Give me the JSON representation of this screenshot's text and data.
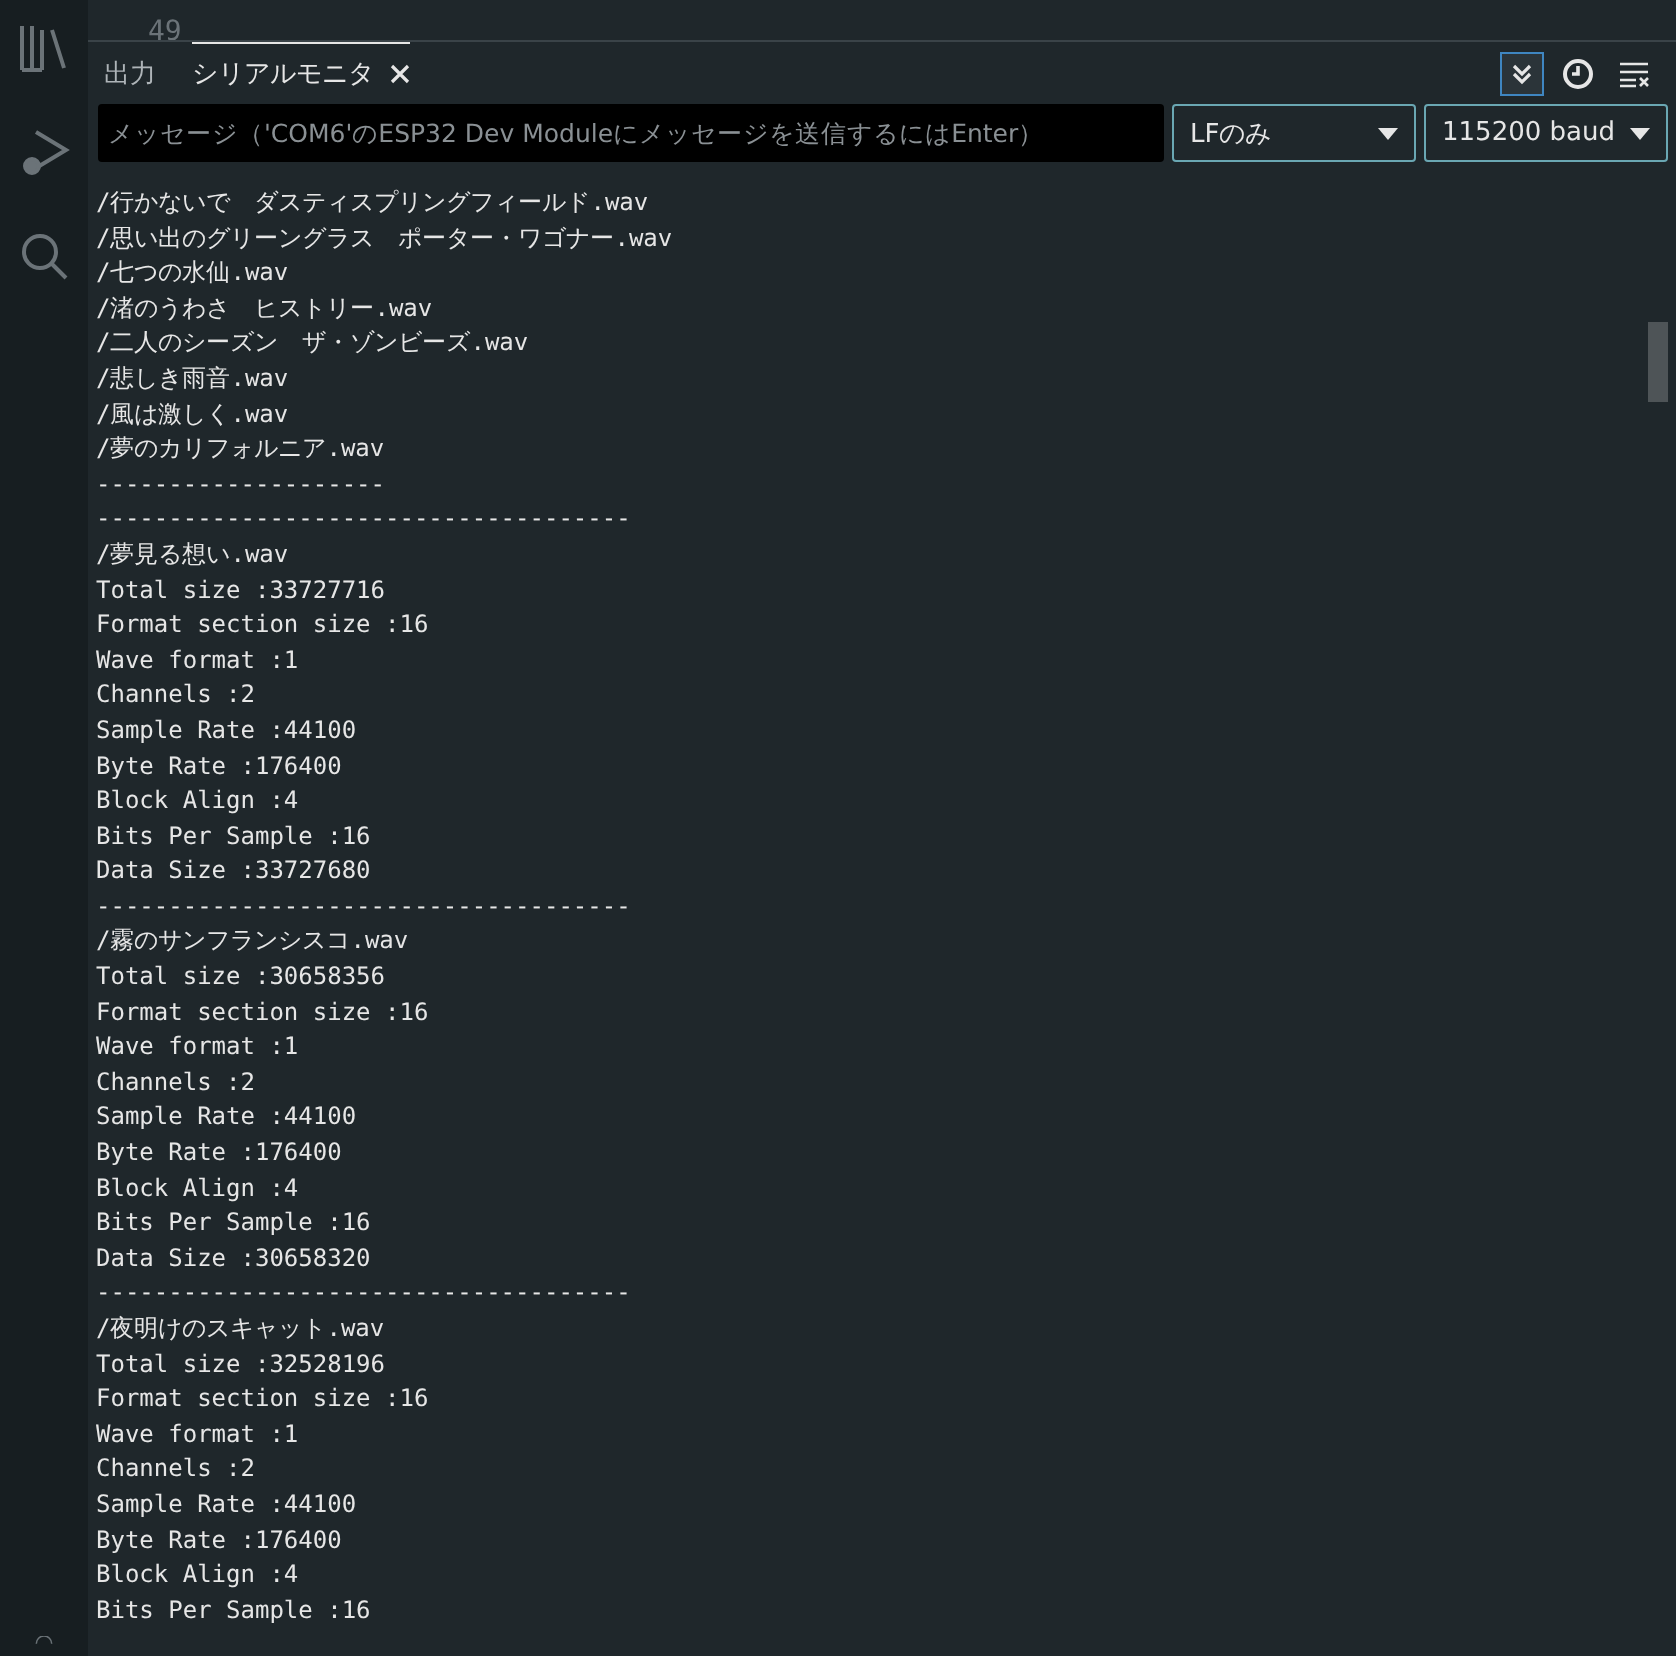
{
  "editor": {
    "line_number": "49"
  },
  "tabs": [
    {
      "label": "出力",
      "selected": false,
      "closable": false
    },
    {
      "label": "シリアルモニタ",
      "selected": true,
      "closable": true
    }
  ],
  "toolbar": {
    "autoscroll_on": true,
    "timestamp_on": false
  },
  "message_field": {
    "placeholder": "メッセージ（'COM6'のESP32 Dev Moduleにメッセージを送信するにはEnter）"
  },
  "line_ending": {
    "value": "LFのみ"
  },
  "baud_rate": {
    "value": "115200 baud"
  },
  "output_lines": [
    "/行かないで　ダスティスプリングフィールド.wav",
    "/思い出のグリーングラス　ポーター・ワゴナー.wav",
    "/七つの水仙.wav",
    "/渚のうわさ　ヒストリー.wav",
    "/二人のシーズン　ザ・ゾンビーズ.wav",
    "/悲しき雨音.wav",
    "/風は激しく.wav",
    "/夢のカリフォルニア.wav",
    "--------------------",
    "-------------------------------------",
    "/夢見る想い.wav",
    "Total size :33727716",
    "Format section size :16",
    "Wave format :1",
    "Channels :2",
    "Sample Rate :44100",
    "Byte Rate :176400",
    "Block Align :4",
    "Bits Per Sample :16",
    "Data Size :33727680",
    "-------------------------------------",
    "/霧のサンフランシスコ.wav",
    "Total size :30658356",
    "Format section size :16",
    "Wave format :1",
    "Channels :2",
    "Sample Rate :44100",
    "Byte Rate :176400",
    "Block Align :4",
    "Bits Per Sample :16",
    "Data Size :30658320",
    "-------------------------------------",
    "/夜明けのスキャット.wav",
    "Total size :32528196",
    "Format section size :16",
    "Wave format :1",
    "Channels :2",
    "Sample Rate :44100",
    "Byte Rate :176400",
    "Block Align :4",
    "Bits Per Sample :16"
  ]
}
